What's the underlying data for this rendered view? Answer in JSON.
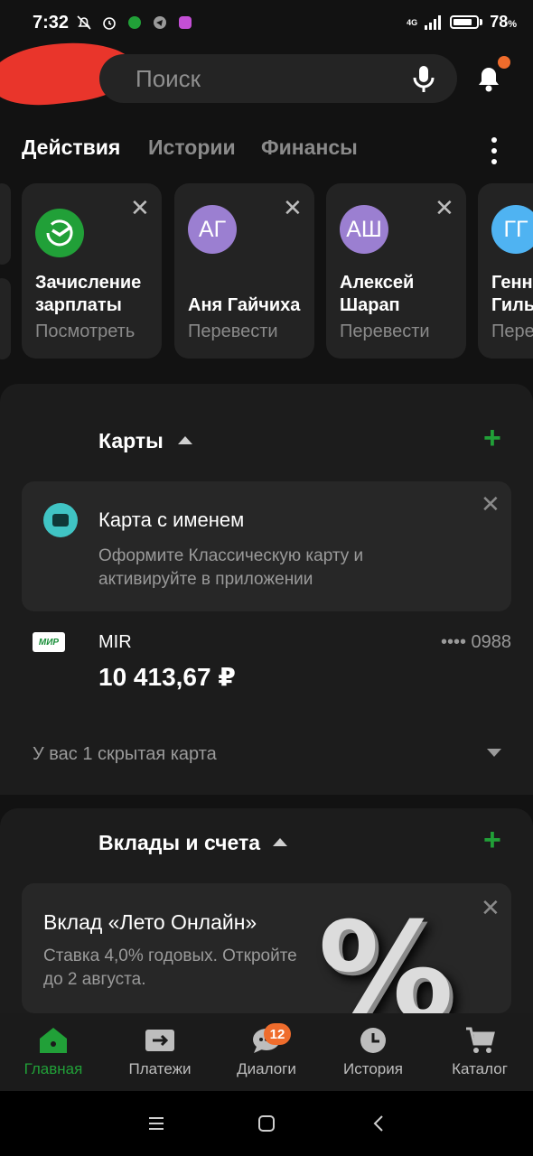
{
  "status_bar": {
    "time": "7:32",
    "network": "4G",
    "battery": "78",
    "battery_unit": "%"
  },
  "search": {
    "placeholder": "Поиск"
  },
  "tabs": [
    {
      "label": "Действия",
      "active": true
    },
    {
      "label": "Истории",
      "active": false
    },
    {
      "label": "Финансы",
      "active": false
    }
  ],
  "quick_actions": [
    {
      "icon": "sber-logo-icon",
      "title_line1": "Зачисление",
      "title_line2": "зарплаты",
      "subtitle": "Посмотреть"
    },
    {
      "initials": "АГ",
      "title_line1": "Аня Гайчиха",
      "title_line2": "",
      "subtitle": "Перевести"
    },
    {
      "initials": "АШ",
      "title_line1": "Алексей",
      "title_line2": "Шарап",
      "subtitle": "Перевести"
    },
    {
      "initials": "ГГ",
      "title_line1": "Генн",
      "title_line2": "Гиль",
      "subtitle": "Пере"
    }
  ],
  "cards_section": {
    "title": "Карты",
    "promo": {
      "title": "Карта с именем",
      "text": "Оформите Классическую карту и активируйте в приложении"
    },
    "card": {
      "logo": "МИР",
      "name": "MIR",
      "number": "•••• 0988",
      "balance": "10 413,67 ₽"
    },
    "hidden_text": "У вас 1 скрытая карта"
  },
  "deposits_section": {
    "title": "Вклады и счета",
    "promo": {
      "title": "Вклад «Лето Онлайн»",
      "text": "Ставка 4,0% годовых. Откройте до 2 августа.",
      "graphic": "%"
    }
  },
  "bottom_nav": [
    {
      "label": "Главная",
      "icon": "home-icon",
      "active": true
    },
    {
      "label": "Платежи",
      "icon": "payments-icon",
      "active": false
    },
    {
      "label": "Диалоги",
      "icon": "dialogs-icon",
      "active": false,
      "badge": "12"
    },
    {
      "label": "История",
      "icon": "clock-icon",
      "active": false
    },
    {
      "label": "Каталог",
      "icon": "cart-icon",
      "active": false
    }
  ],
  "colors": {
    "accent_green": "#21a038",
    "badge_orange": "#ef6c2c",
    "avatar_purple": "#9b7fd1",
    "avatar_blue": "#4fb3f2",
    "card_icon_teal": "#40c4c4"
  }
}
